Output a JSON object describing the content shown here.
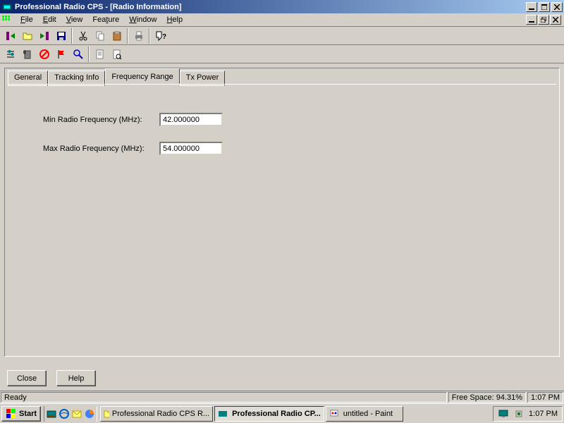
{
  "title": "Professional Radio CPS - [Radio Information]",
  "menu": {
    "file": "File",
    "edit": "Edit",
    "view": "View",
    "feature": "Feature",
    "window": "Window",
    "help": "Help"
  },
  "tabs": {
    "general": "General",
    "tracking_info": "Tracking Info",
    "frequency_range": "Frequency Range",
    "tx_power": "Tx Power"
  },
  "form": {
    "min_freq_label": "Min Radio Frequency (MHz):",
    "min_freq_value": "42.000000",
    "max_freq_label": "Max Radio Frequency (MHz):",
    "max_freq_value": "54.000000"
  },
  "buttons": {
    "close": "Close",
    "help": "Help"
  },
  "status": {
    "ready": "Ready",
    "free_space": "Free Space:  94.31%",
    "time": "1:07 PM"
  },
  "taskbar": {
    "start": "Start",
    "task1": "Professional Radio CPS R...",
    "task2": "Professional Radio CP...",
    "task3": "untitled - Paint",
    "clock": "1:07 PM"
  }
}
